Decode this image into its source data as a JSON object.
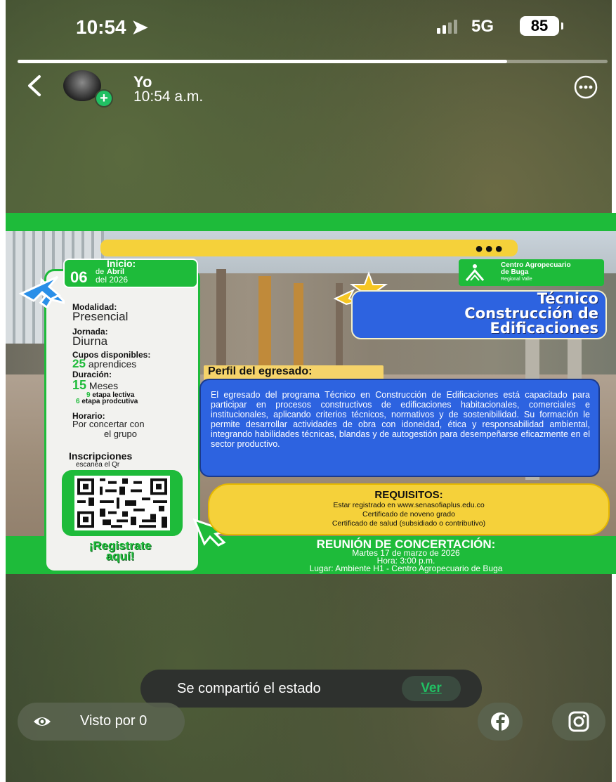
{
  "status_bar": {
    "time": "10:54",
    "network": "5G",
    "battery": "85"
  },
  "story": {
    "progress": 0.83
  },
  "header": {
    "username": "Yo",
    "post_time": "10:54 a.m."
  },
  "poster": {
    "inicio": {
      "label": "Inicio:",
      "day": "06",
      "de": "de",
      "month": "Abril",
      "year": "del 2026"
    },
    "modalidad": {
      "label": "Modalidad:",
      "value": "Presencial"
    },
    "jornada": {
      "label": "Jornada:",
      "value": "Diurna"
    },
    "cupos": {
      "label": "Cupos disponibles:",
      "count": "25",
      "unit": "aprendices"
    },
    "duracion": {
      "label": "Duración:",
      "count": "15",
      "unit": "Meses",
      "lectiva_n": "9",
      "lectiva": "etapa lectiva",
      "productiva_n": "6",
      "productiva": "etapa prodcutiva"
    },
    "horario": {
      "label": "Horario:",
      "line1": "Por concertar con",
      "line2": "el grupo"
    },
    "inscripciones": {
      "title": "Inscripciones",
      "sub": "escanea el Qr"
    },
    "registrate": {
      "line1": "¡Registrate",
      "line2": "aquí!"
    },
    "logo": {
      "line1": "Centro Agropecuario",
      "line2": "de Buga",
      "line3": "Regional Valle"
    },
    "title": {
      "line1": "Técnico",
      "line2": "Construcción de",
      "line3": "Edificaciones"
    },
    "perfil": {
      "title": "Perfil del egresado:",
      "text": "El egresado del programa Técnico en Construcción de Edificaciones está capacitado para participar en procesos constructivos de edificaciones habitacionales, comerciales e institucionales, aplicando criterios técnicos, normativos y de sostenibilidad. Su formación le permite desarrollar actividades de obra con idoneidad, ética y responsabilidad ambiental, integrando habilidades técnicas, blandas y de autogestión para desempeñarse eficazmente en el sector productivo."
    },
    "requisitos": {
      "title": "REQUISITOS:",
      "items": [
        "Estar registrado en www.senasofiaplus.edu.co",
        "Certificado de noveno grado",
        "Certificado de salud (subsidiado o contributivo)"
      ]
    },
    "reunion": {
      "title": "REUNIÓN DE CONCERTACIÓN:",
      "date": "Martes 17 de marzo de 2026",
      "hour": "Hora: 3:00 p.m.",
      "place": "Lugar: Ambiente H1 - Centro Agropecuario de Buga"
    }
  },
  "toast": {
    "text": "Se compartió el estado",
    "action": "Ver"
  },
  "footer": {
    "seen": "Visto por 0"
  },
  "icons": {
    "eye": "eye-icon",
    "facebook": "facebook-icon",
    "instagram": "instagram-icon"
  },
  "colors": {
    "green": "#1ebb3a",
    "blue": "#2d63e0",
    "yellow": "#f5d13a",
    "whatsapp_green": "#21c063"
  }
}
